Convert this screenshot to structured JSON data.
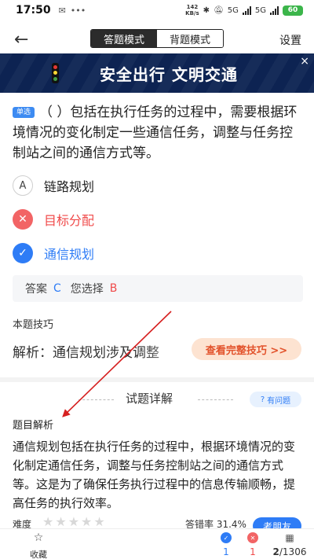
{
  "status": {
    "time": "17:50",
    "net_speed_top": "142",
    "net_speed_bottom": "KB/s",
    "signal_1": "5G",
    "signal_2": "5G",
    "battery": "60"
  },
  "header": {
    "mode_active": "答题模式",
    "mode_inactive": "背题模式",
    "settings": "设置"
  },
  "banner": {
    "text": "安全出行 文明交通",
    "close": "×"
  },
  "question": {
    "type_tag": "单选",
    "text": "（   ）包括在执行任务的过程中，需要根据环境情况的变化制定一些通信任务，调整与任务控制站之间的通信方式等。"
  },
  "options": [
    {
      "letter": "A",
      "label": "链路规划",
      "state": "plain"
    },
    {
      "letter": "✕",
      "label": "目标分配",
      "state": "wrong"
    },
    {
      "letter": "✓",
      "label": "通信规划",
      "state": "right"
    }
  ],
  "answer": {
    "answer_label": "答案",
    "correct": "C",
    "chosen_label": "您选择",
    "chosen": "B"
  },
  "tips": {
    "title": "本题技巧",
    "text": "解析：通信规划涉及调整",
    "button": "查看完整技巧 >>"
  },
  "detail": {
    "title": "试题详解",
    "report": "有问题"
  },
  "analysis": {
    "title": "题目解析",
    "text": "通信规划包括在执行任务的过程中，根据环境情况的变化制定通信任务，调整与任务控制站之间的通信方式等。这是为了确保任务执行过程中的信息传输顺畅，提高任务的执行效率。"
  },
  "meta": {
    "difficulty_label": "难度",
    "stars": "★★★★★",
    "error_rate": "答错率 31.4%",
    "ask_button": "考朋友"
  },
  "bottom": {
    "favorite": "收藏",
    "correct_count": "1",
    "wrong_count": "1",
    "progress_current": "2",
    "progress_total": "/1306"
  },
  "colors": {
    "accent_blue": "#2e7cf6",
    "wrong_red": "#f26465",
    "banner_navy": "#0d2352",
    "tip_orange": "#e2522b",
    "annotation_arrow": "#d62020"
  }
}
